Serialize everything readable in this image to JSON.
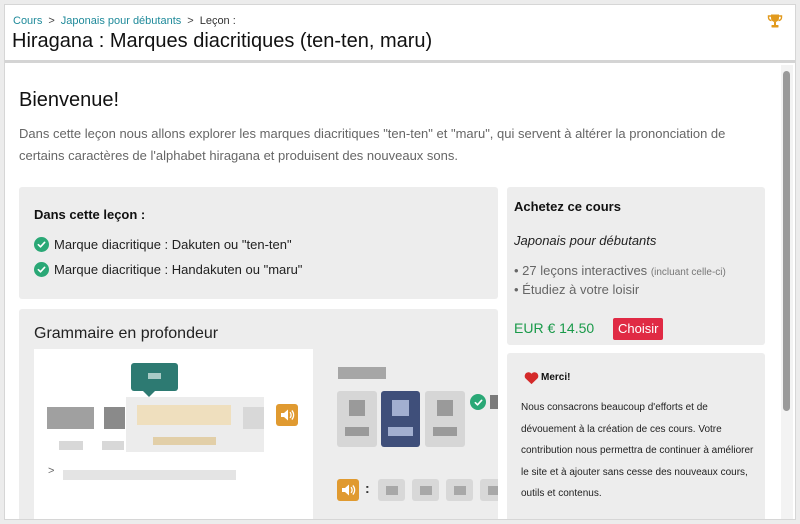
{
  "breadcrumb": {
    "items": [
      "Cours",
      "Japonais pour débutants",
      "Leçon :"
    ],
    "separator": ">"
  },
  "header": {
    "title": "Hiragana : Marques diacritiques (ten-ten, maru)",
    "trophy_icon": "trophy-icon"
  },
  "welcome": {
    "title": "Bienvenue!",
    "intro": "Dans cette leçon nous allons explorer les marques diacritiques \"ten-ten\" et \"maru\", qui servent à altérer la prononciation de certains caractères de l'alphabet hiragana et produisent des nouveaux sons."
  },
  "lesson": {
    "heading": "Dans cette leçon :",
    "items": [
      "Marque diacritique : Dakuten ou \"ten-ten\"",
      "Marque diacritique : Handakuten ou \"maru\""
    ]
  },
  "grammar": {
    "title": "Grammaire en profondeur",
    "prompt_glyph": ">",
    "colon_glyph": ":"
  },
  "buy": {
    "title": "Achetez ce cours",
    "course": "Japonais pour débutants",
    "features": [
      {
        "text": "27 leçons interactives",
        "note": "(incluant celle-ci)"
      },
      {
        "text": "Étudiez à votre loisir",
        "note": ""
      }
    ],
    "price": "EUR € 14.50",
    "button": "Choisir"
  },
  "thanks": {
    "title": "Merci!",
    "text": "Nous consacrons beaucoup d'efforts et de dévouement à la création de ces cours. Votre contribution nous permettra de continuer à améliorer le site et à ajouter sans cesse des nouveaux cours, outils et contenus."
  },
  "colors": {
    "link": "#1f8a9a",
    "check": "#2aa876",
    "price": "#1a9a4a",
    "button": "#e02a44",
    "audio": "#e09a30",
    "panel": "#ededed"
  }
}
